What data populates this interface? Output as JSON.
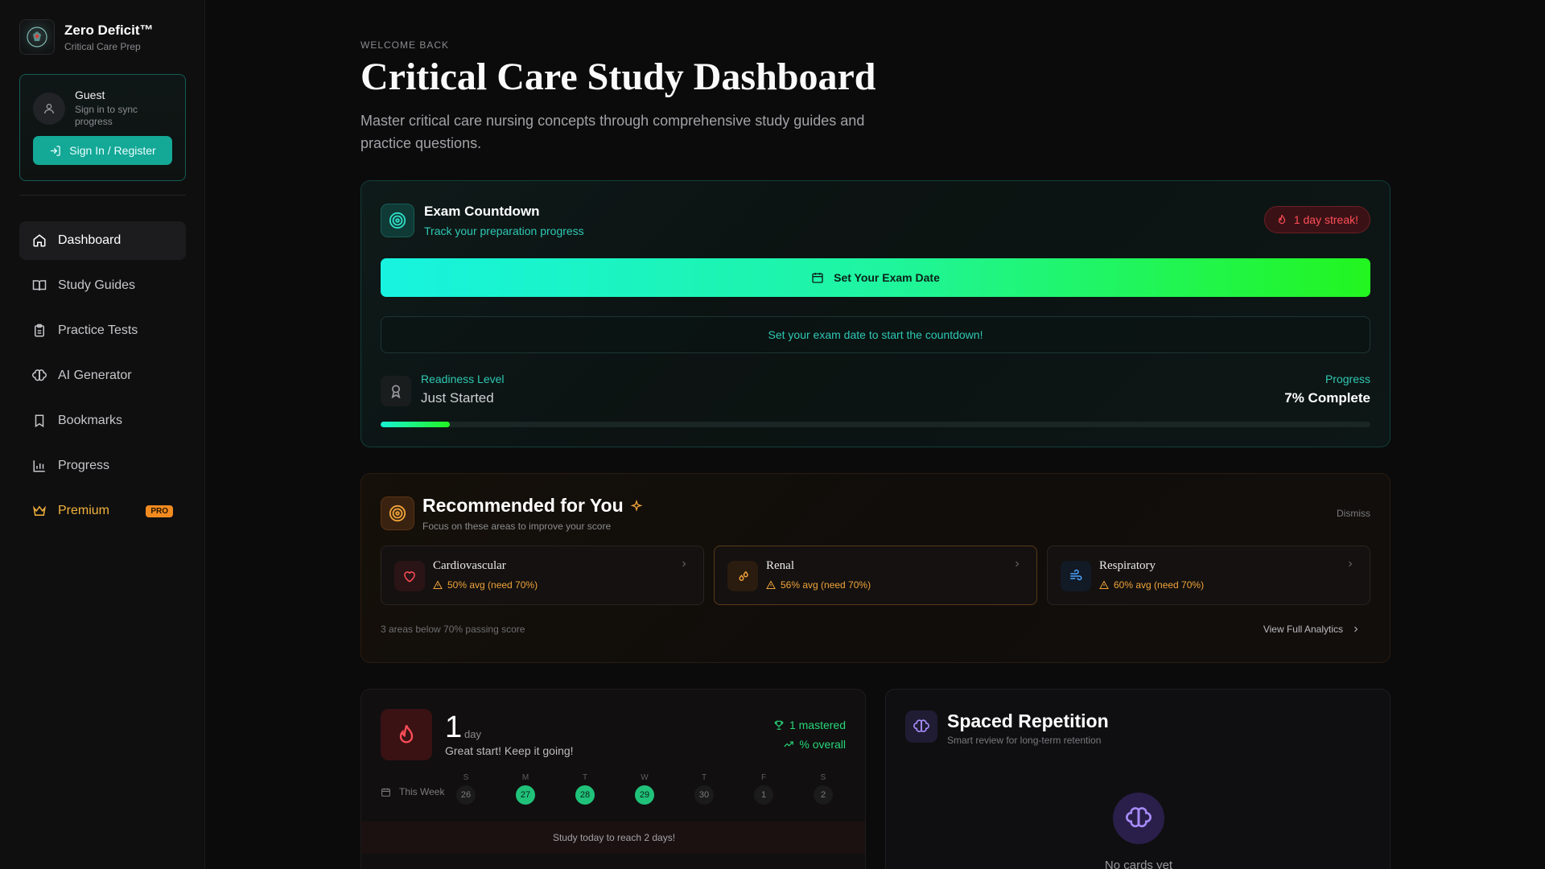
{
  "brand": {
    "title": "Zero Deficit™",
    "subtitle": "Critical Care Prep"
  },
  "guest": {
    "name": "Guest",
    "subtitle": "Sign in to sync progress",
    "signin_label": "Sign In / Register"
  },
  "nav": {
    "items": [
      {
        "label": "Dashboard",
        "icon": "home-icon",
        "active": true
      },
      {
        "label": "Study Guides",
        "icon": "book-open-icon"
      },
      {
        "label": "Practice Tests",
        "icon": "clipboard-icon"
      },
      {
        "label": "AI Generator",
        "icon": "brain-icon"
      },
      {
        "label": "Bookmarks",
        "icon": "bookmark-icon"
      },
      {
        "label": "Progress",
        "icon": "bar-chart-icon"
      },
      {
        "label": "Premium",
        "icon": "crown-icon",
        "badge": "PRO"
      }
    ]
  },
  "header": {
    "welcome": "WELCOME BACK",
    "title": "Critical Care Study Dashboard",
    "description": "Master critical care nursing concepts through comprehensive study guides and practice questions."
  },
  "exam": {
    "title": "Exam Countdown",
    "subtitle": "Track your preparation progress",
    "streak_badge": "1 day streak!",
    "set_date_label": "Set Your Exam Date",
    "countdown_message": "Set your exam date to start the countdown!",
    "readiness_label": "Readiness Level",
    "readiness_value": "Just Started",
    "progress_label": "Progress",
    "progress_value": "7% Complete",
    "progress_percent": 7
  },
  "recommended": {
    "title": "Recommended for You",
    "subtitle": "Focus on these areas to improve your score",
    "dismiss_label": "Dismiss",
    "topics": [
      {
        "name": "Cardiovascular",
        "stat": "50% avg (need 70%)",
        "icon": "heart-icon",
        "color": "#ff4d57"
      },
      {
        "name": "Renal",
        "stat": "56% avg (need 70%)",
        "icon": "droplets-icon",
        "color": "#f0a43a"
      },
      {
        "name": "Respiratory",
        "stat": "60% avg (need 70%)",
        "icon": "wind-icon",
        "color": "#4aa3ff"
      }
    ],
    "footer": "3 areas below 70% passing score",
    "analytics_label": "View Full Analytics"
  },
  "streak": {
    "count": "1",
    "unit": "day",
    "message": "Great start! Keep it going!",
    "mastered": "1 mastered",
    "overall": "% overall",
    "week_label": "This Week",
    "days": [
      {
        "letter": "S",
        "num": "26",
        "done": false
      },
      {
        "letter": "M",
        "num": "27",
        "done": true
      },
      {
        "letter": "T",
        "num": "28",
        "done": true
      },
      {
        "letter": "W",
        "num": "29",
        "done": true
      },
      {
        "letter": "T",
        "num": "30",
        "done": false
      },
      {
        "letter": "F",
        "num": "1",
        "done": false
      },
      {
        "letter": "S",
        "num": "2",
        "done": false
      }
    ],
    "footer": "Study today to reach 2 days!"
  },
  "spaced": {
    "title": "Spaced Repetition",
    "subtitle": "Smart review for long-term retention",
    "empty_text": "No cards yet"
  },
  "colors": {
    "teal": "#2fc8b4",
    "accent_green": "#22f51f",
    "danger": "#ff4d57",
    "warning": "#f0a43a"
  }
}
